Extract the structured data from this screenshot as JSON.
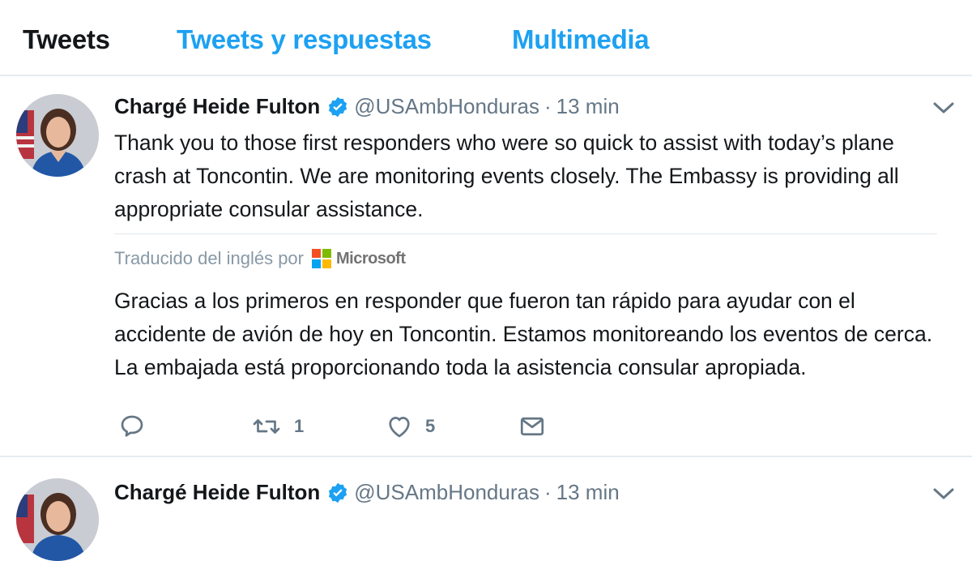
{
  "tabs": [
    {
      "label": "Tweets",
      "active": true
    },
    {
      "label": "Tweets y respuestas",
      "active": false
    },
    {
      "label": "Multimedia",
      "active": false
    }
  ],
  "tweets": [
    {
      "name": "Chargé Heide Fulton",
      "handle": "@USAmbHonduras",
      "separator": "·",
      "time": "13 min",
      "text": "Thank you to those first responders who were so quick to assist with today’s plane crash at Toncontin. We are monitoring events closely. The Embassy is providing all appropriate consular assistance.",
      "translated_label": "Traducido del inglés por",
      "translator": "Microsoft",
      "translation": "Gracias a los primeros en responder que fueron tan rápido para ayudar con el accidente de avión de hoy en Toncontin. Estamos monitoreando los eventos de cerca. La embajada está proporcionando toda la asistencia consular apropiada.",
      "retweets": "1",
      "likes": "5"
    },
    {
      "name": "Chargé Heide Fulton",
      "handle": "@USAmbHonduras",
      "separator": "·",
      "time": "13 min"
    }
  ],
  "icons": {
    "verified": "verified-badge-icon",
    "caret": "chevron-down-icon",
    "reply": "reply-icon",
    "retweet": "retweet-icon",
    "like": "heart-icon",
    "dm": "envelope-icon"
  },
  "colors": {
    "accent": "#1da1f2",
    "muted": "#657786",
    "text": "#14171a",
    "border": "#e6ecf0"
  }
}
